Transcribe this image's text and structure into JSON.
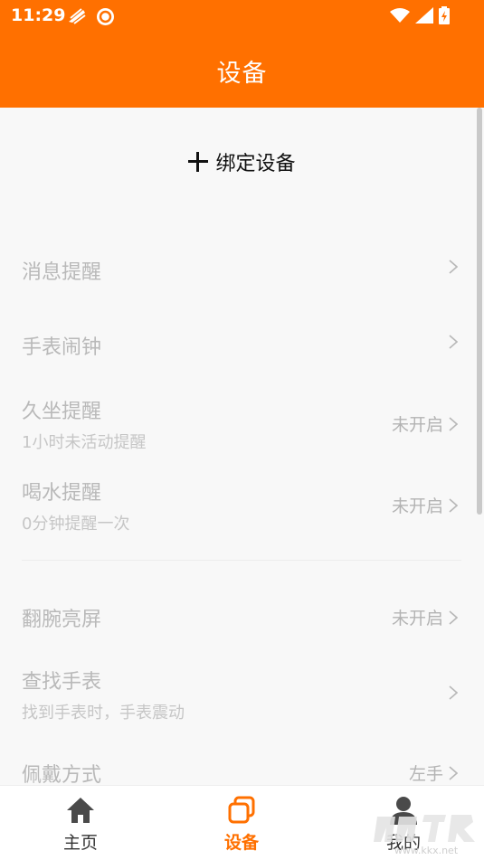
{
  "status_bar": {
    "time": "11:29"
  },
  "header": {
    "title": "设备"
  },
  "bind": {
    "label": "绑定设备"
  },
  "settings": [
    {
      "label": "消息提醒",
      "sub": "",
      "value": ""
    },
    {
      "label": "手表闹钟",
      "sub": "",
      "value": ""
    },
    {
      "label": "久坐提醒",
      "sub": "1小时未活动提醒",
      "value": "未开启"
    },
    {
      "label": "喝水提醒",
      "sub": "0分钟提醒一次",
      "value": "未开启"
    },
    {
      "label": "翻腕亮屏",
      "sub": "",
      "value": "未开启"
    },
    {
      "label": "查找手表",
      "sub": "找到手表时，手表震动",
      "value": ""
    },
    {
      "label": "佩戴方式",
      "sub": "",
      "value": "左手"
    }
  ],
  "tabs": [
    {
      "label": "主页",
      "icon": "home-icon",
      "active": false
    },
    {
      "label": "设备",
      "icon": "device-icon",
      "active": true
    },
    {
      "label": "我的",
      "icon": "user-icon",
      "active": false
    }
  ],
  "watermark": {
    "text": "www.kkx.net"
  },
  "colors": {
    "accent": "#ff7000",
    "text_muted": "#b9b9b9",
    "background": "#f8f8f8"
  }
}
